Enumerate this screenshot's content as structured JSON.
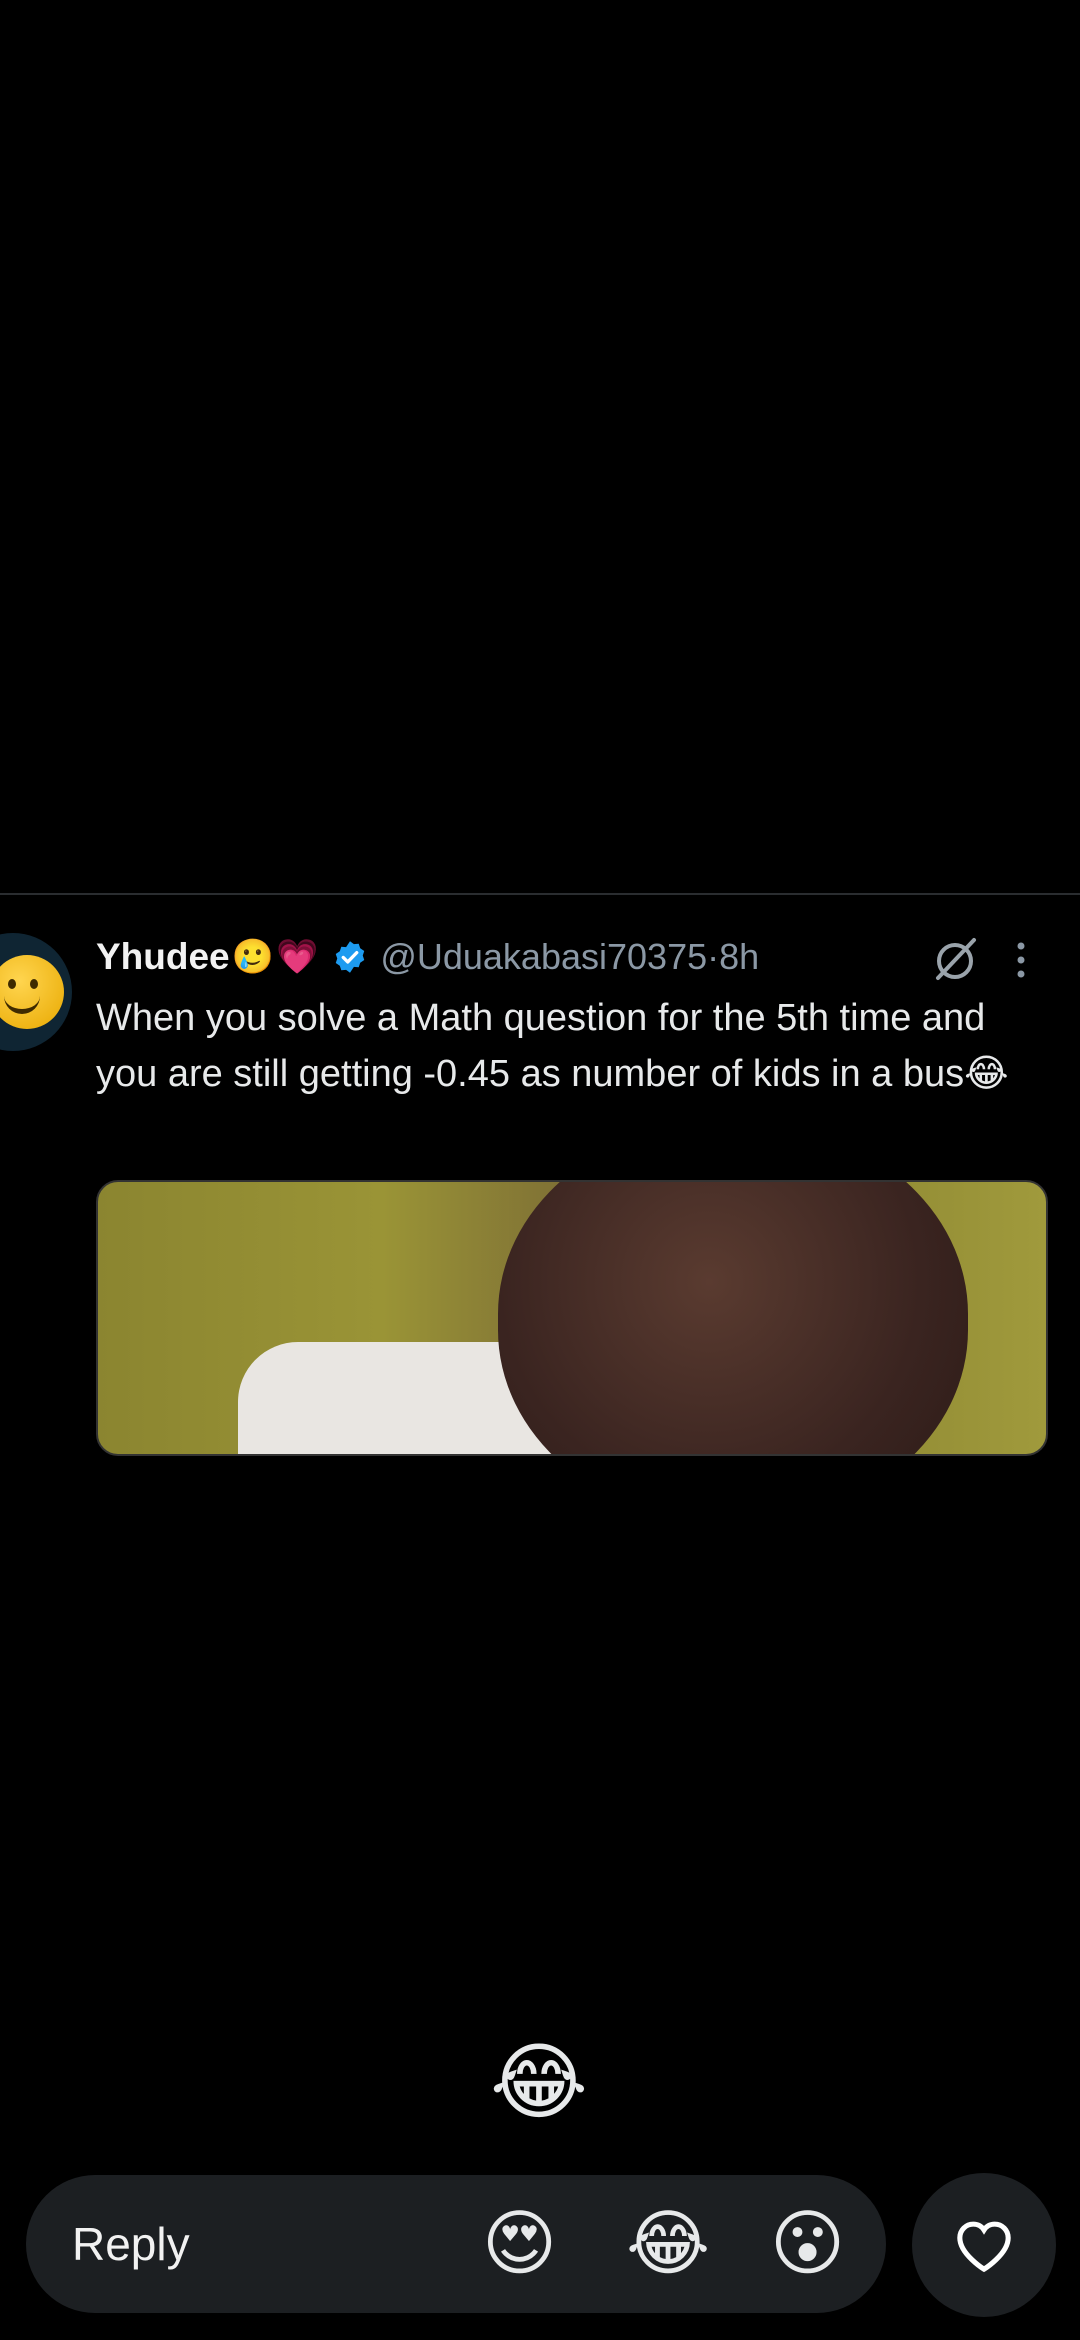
{
  "tweet": {
    "display_name": "Yhudee",
    "name_emojis": [
      "🥲",
      "💗"
    ],
    "handle": "@Uduakabasi70375",
    "separator": " · ",
    "time": "8h",
    "text": "When you solve a Math question for the 5th time and you are still getting -0.45 as number of kids in a bus😂",
    "icons": [
      "avatar-smiley-icon",
      "verified-badge-icon",
      "grok-icon",
      "more-vertical-icon"
    ],
    "accent_color": "#1d9bf0"
  },
  "overlay": {
    "floating_reaction": "😂"
  },
  "reply_bar": {
    "reply_label": "Reply",
    "reactions": [
      "😍",
      "😂",
      "😮"
    ],
    "like_icon": "heart-outline-icon"
  }
}
